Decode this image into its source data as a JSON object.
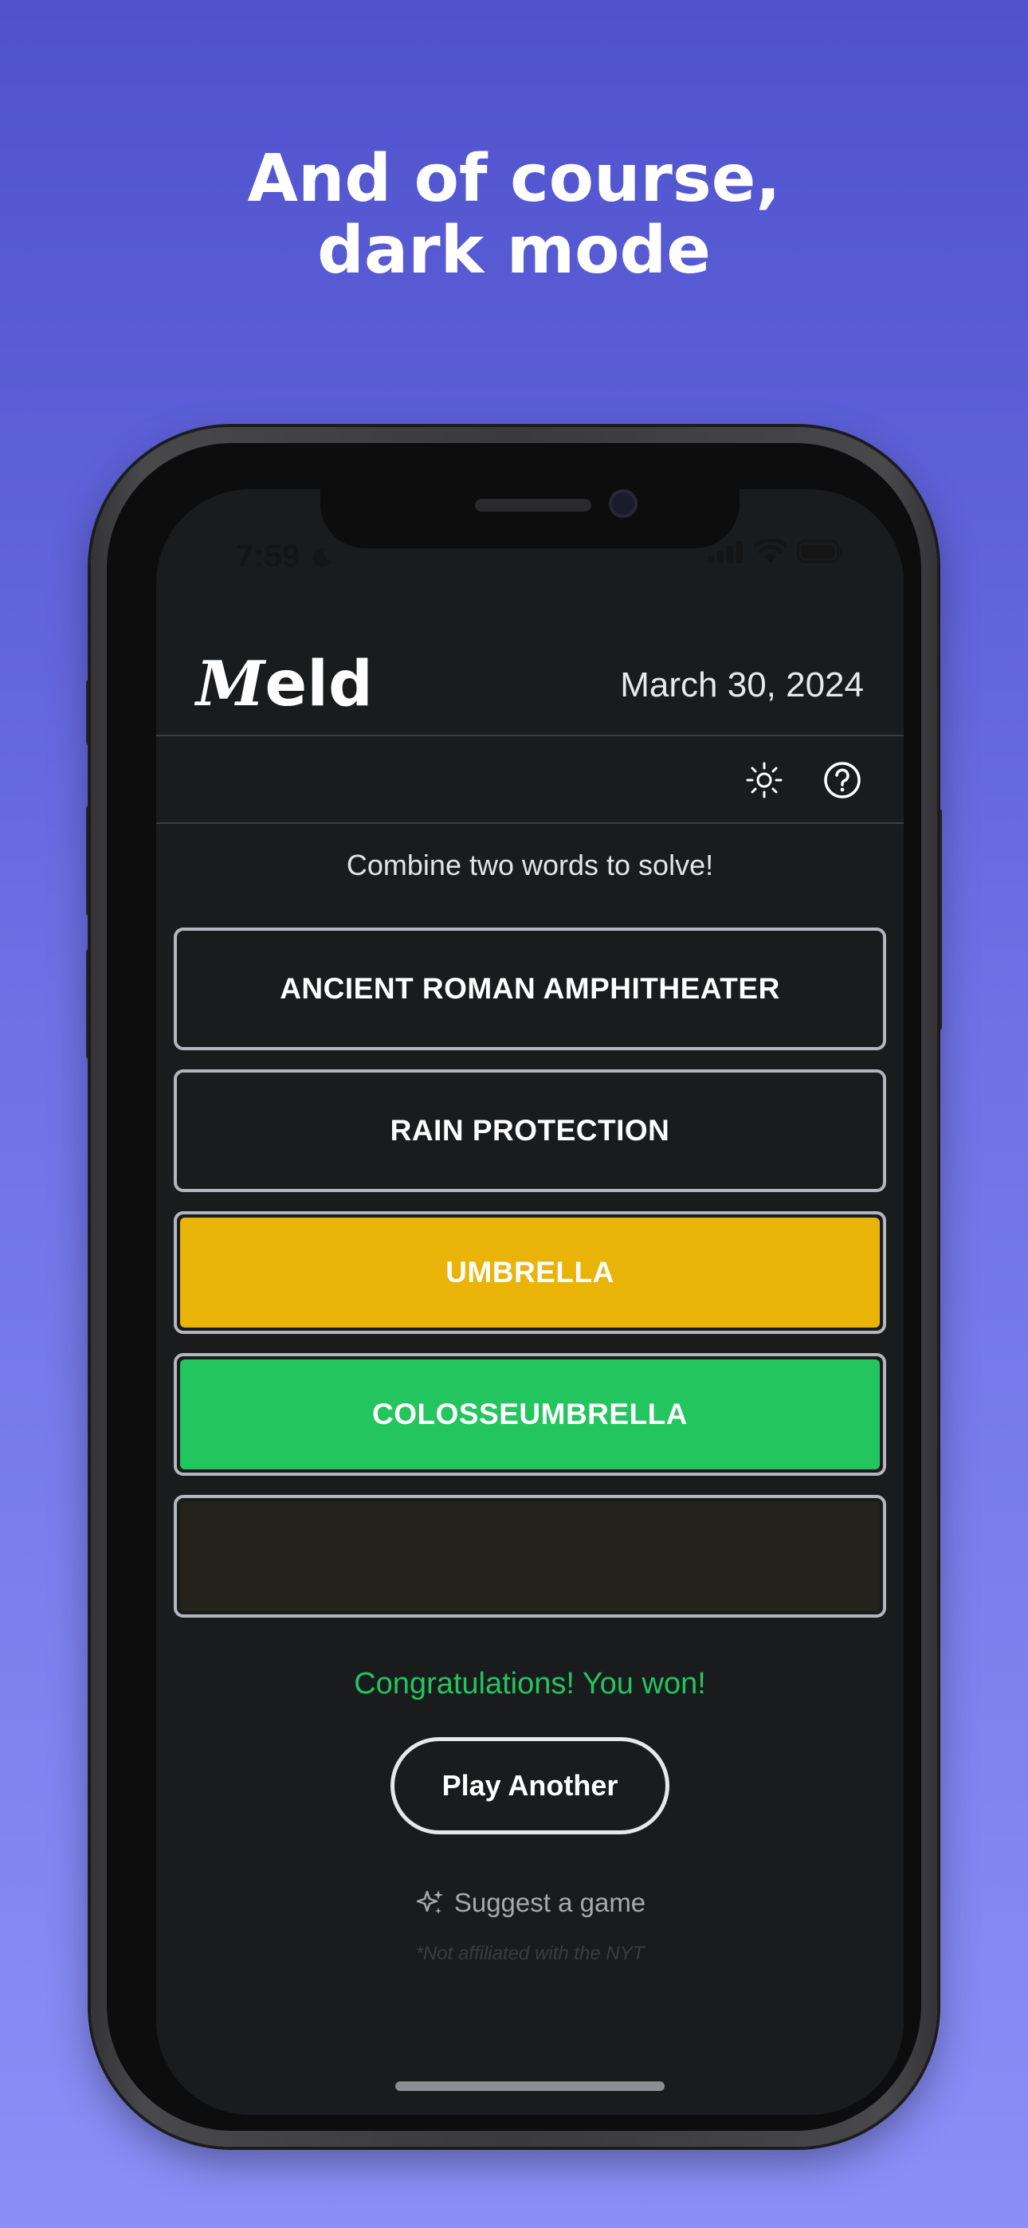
{
  "promo": {
    "headline_line1": "And of course,",
    "headline_line2": "dark mode"
  },
  "status_bar": {
    "time": "7:59",
    "icons": [
      "moon-icon",
      "cellular-signal-icon",
      "wifi-icon",
      "battery-icon"
    ]
  },
  "header": {
    "logo_first_letter": "M",
    "logo_rest": "eld",
    "date": "March 30, 2024"
  },
  "toolbar": {
    "icons": [
      "sun-icon",
      "help-icon"
    ]
  },
  "game": {
    "instructions": "Combine two words to solve!",
    "cards": [
      {
        "label": "ANCIENT ROMAN AMPHITHEATER",
        "color": "#1a1b1d"
      },
      {
        "label": "RAIN PROTECTION",
        "color": "#1a1b1d"
      },
      {
        "label": "UMBRELLA",
        "color": "#eab308"
      },
      {
        "label": "COLOSSEUMBRELLA",
        "color": "#22c55e"
      },
      {
        "label": "",
        "color": "#23231b"
      }
    ],
    "result_message": "Congratulations! You won!",
    "result_color": "#22c55e",
    "play_another_label": "Play Another"
  },
  "footer": {
    "suggest_label": "Suggest a game",
    "suggest_icon": "sparkles-icon",
    "disclaimer": "*Not affiliated with the NYT"
  },
  "colors": {
    "background_top": "#4f52cc",
    "background_bottom": "#8a8ff7",
    "screen_background": "#1a1b1d",
    "card_border": "#b3b7bd"
  }
}
